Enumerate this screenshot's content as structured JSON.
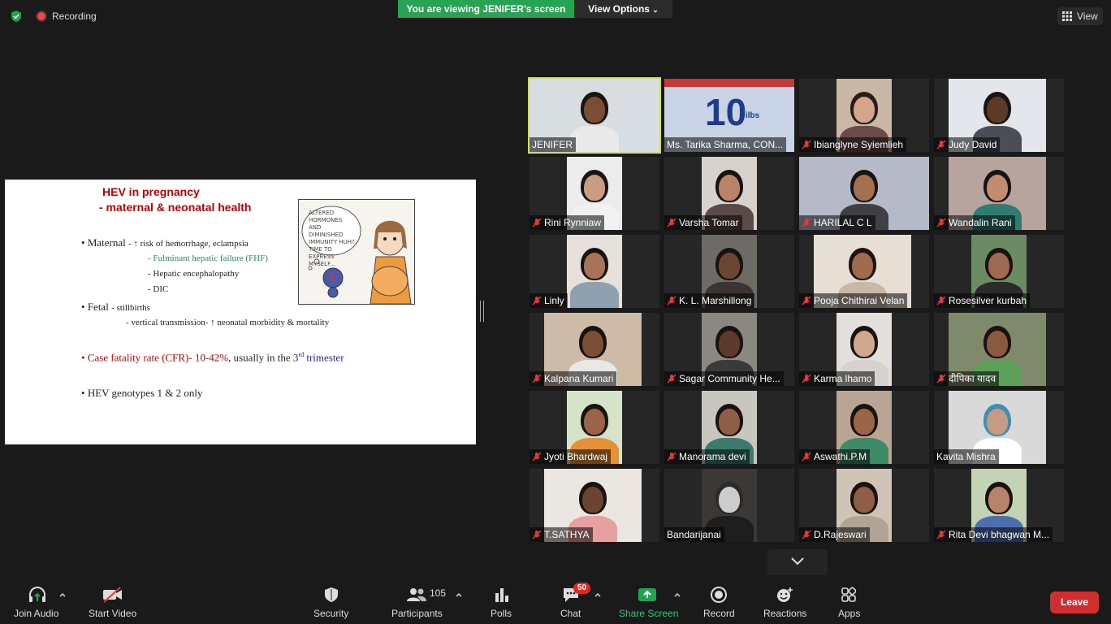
{
  "topbar": {
    "recording_label": "Recording",
    "viewing_banner": "You are viewing JENIFER's screen",
    "view_options_label": "View Options",
    "view_label": "View",
    "colors": {
      "banner": "#26a454",
      "recording": "#e34b4b"
    }
  },
  "slide": {
    "title_line1": "HEV in pregnancy",
    "title_line2": "- maternal & neonatal health",
    "maternal_label": "Maternal",
    "maternal_item1": "- ↑ risk of hemorrhage, eclampsia",
    "maternal_item2": "- Fulminant hepatic failure (FHF)",
    "maternal_item3": "- Hepatic encephalopathy",
    "maternal_item4": "- DIC",
    "fetal_label": "Fetal",
    "fetal_item1": "- stillbirths",
    "fetal_item2": "- vertical transmission- ↑ neonatal morbidity & mortality",
    "cfr_part1": "Case fatality rate (CFR)- 10-42%",
    "cfr_part2": ", usually in the ",
    "cfr_part3": "3",
    "cfr_sup": "rd",
    "cfr_part4": " trimester",
    "genotype_line": "HEV genotypes 1 & 2 only",
    "cartoon_text": "ALTERED HORMONES AND DIMINISHED IMMUNITY HUH? TIME TO EXPRESS MYSELF...",
    "cartoon_letter": "E"
  },
  "participants": [
    {
      "name": "JENIFER",
      "muted": false,
      "active": true
    },
    {
      "name": "Ms. Tarika Sharma, CON...",
      "muted": false
    },
    {
      "name": "Ibianglyne Syiemlieh",
      "muted": true
    },
    {
      "name": "Judy David",
      "muted": true
    },
    {
      "name": "Rini Rynniaw",
      "muted": true
    },
    {
      "name": "Varsha Tomar",
      "muted": true
    },
    {
      "name": "HARILAL C L",
      "muted": true
    },
    {
      "name": "Wandalin Rani",
      "muted": true
    },
    {
      "name": "Linly",
      "muted": true
    },
    {
      "name": "K. L. Marshillong",
      "muted": true
    },
    {
      "name": "Pooja Chithirai Velan",
      "muted": true
    },
    {
      "name": "Rosesilver kurbah",
      "muted": true
    },
    {
      "name": "Kalpana Kumari",
      "muted": true
    },
    {
      "name": "Sagar Community He...",
      "muted": true
    },
    {
      "name": "Karma lhamo",
      "muted": true
    },
    {
      "name": "दीपिका यादव",
      "muted": true
    },
    {
      "name": "Jyoti Bhardwaj",
      "muted": true
    },
    {
      "name": "Manorama devi",
      "muted": true
    },
    {
      "name": "Aswathi.P.M",
      "muted": true
    },
    {
      "name": "Kavita Mishra",
      "muted": false
    },
    {
      "name": "T.SATHYA",
      "muted": true
    },
    {
      "name": "Bandarijanai",
      "muted": false
    },
    {
      "name": "D.Rajeswari",
      "muted": true
    },
    {
      "name": "Rita Devi bhagwan M...",
      "muted": true
    }
  ],
  "tile_banner_text": "10",
  "tile_banner_sub": "ilbs",
  "toolbar": {
    "join_audio": "Join Audio",
    "start_video": "Start Video",
    "security": "Security",
    "participants": "Participants",
    "participants_count": "105",
    "polls": "Polls",
    "chat": "Chat",
    "chat_badge": "50",
    "share_screen": "Share Screen",
    "record": "Record",
    "reactions": "Reactions",
    "apps": "Apps",
    "leave": "Leave"
  }
}
